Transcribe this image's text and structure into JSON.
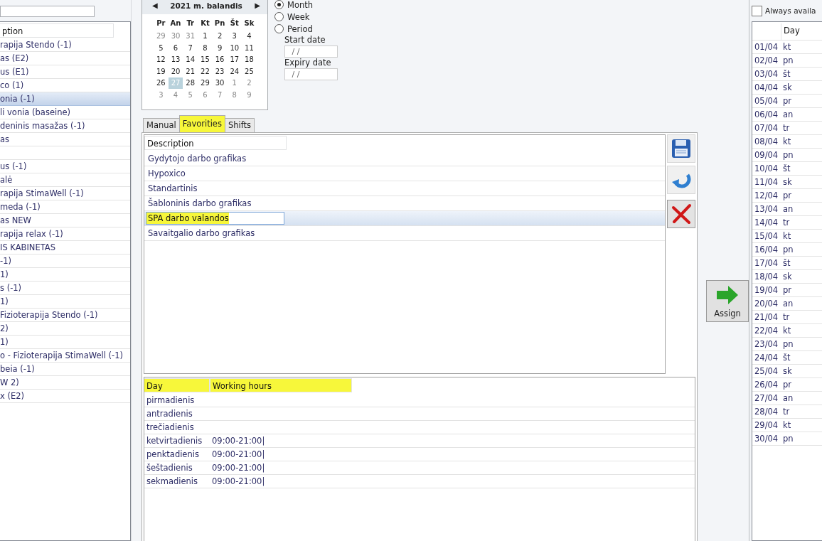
{
  "left_panel": {
    "column": "ption",
    "rows": [
      {
        "text": "rapija Stendo (-1)",
        "selected": false
      },
      {
        "text": "as (E2)",
        "selected": false
      },
      {
        "text": "us (E1)",
        "selected": false
      },
      {
        "text": "co (1)",
        "selected": false
      },
      {
        "text": "onia (-1)",
        "selected": true
      },
      {
        "text": "li vonia (baseine)",
        "selected": false
      },
      {
        "text": "deninis masažas (-1)",
        "selected": false
      },
      {
        "text": "as",
        "selected": false
      },
      {
        "text": "",
        "selected": false
      },
      {
        "text": "us (-1)",
        "selected": false
      },
      {
        "text": "alė",
        "selected": false
      },
      {
        "text": "rapija StimaWell (-1)",
        "selected": false
      },
      {
        "text": "meda (-1)",
        "selected": false
      },
      {
        "text": "as NEW",
        "selected": false
      },
      {
        "text": "rapija relax (-1)",
        "selected": false
      },
      {
        "text": "IS KABINETAS",
        "selected": false
      },
      {
        "text": "-1)",
        "selected": false
      },
      {
        "text": "1)",
        "selected": false
      },
      {
        "text": "s (-1)",
        "selected": false
      },
      {
        "text": "1)",
        "selected": false
      },
      {
        "text": " Fizioterapija Stendo (-1)",
        "selected": false
      },
      {
        "text": "2)",
        "selected": false
      },
      {
        "text": "1)",
        "selected": false
      },
      {
        "text": "o - Fizioterapija StimaWell (-1)",
        "selected": false
      },
      {
        "text": "beia (-1)",
        "selected": false
      },
      {
        "text": "W 2)",
        "selected": false
      },
      {
        "text": "x (E2)",
        "selected": false
      }
    ]
  },
  "calendar": {
    "title": "2021 m. balandis",
    "prev": "◀",
    "next": "▶",
    "weekdays": [
      "Pr",
      "An",
      "Tr",
      "Kt",
      "Pn",
      "Št",
      "Sk"
    ],
    "weeks": [
      [
        {
          "d": "29",
          "other": true,
          "selected": false
        },
        {
          "d": "30",
          "other": true,
          "selected": false
        },
        {
          "d": "31",
          "other": true,
          "selected": false
        },
        {
          "d": "1",
          "other": false,
          "selected": false
        },
        {
          "d": "2",
          "other": false,
          "selected": false
        },
        {
          "d": "3",
          "other": false,
          "selected": false
        },
        {
          "d": "4",
          "other": false,
          "selected": false
        }
      ],
      [
        {
          "d": "5",
          "other": false,
          "selected": false
        },
        {
          "d": "6",
          "other": false,
          "selected": false
        },
        {
          "d": "7",
          "other": false,
          "selected": false
        },
        {
          "d": "8",
          "other": false,
          "selected": false
        },
        {
          "d": "9",
          "other": false,
          "selected": false
        },
        {
          "d": "10",
          "other": false,
          "selected": false
        },
        {
          "d": "11",
          "other": false,
          "selected": false
        }
      ],
      [
        {
          "d": "12",
          "other": false,
          "selected": false
        },
        {
          "d": "13",
          "other": false,
          "selected": false
        },
        {
          "d": "14",
          "other": false,
          "selected": false
        },
        {
          "d": "15",
          "other": false,
          "selected": false
        },
        {
          "d": "16",
          "other": false,
          "selected": false
        },
        {
          "d": "17",
          "other": false,
          "selected": false
        },
        {
          "d": "18",
          "other": false,
          "selected": false
        }
      ],
      [
        {
          "d": "19",
          "other": false,
          "selected": false
        },
        {
          "d": "20",
          "other": false,
          "selected": false
        },
        {
          "d": "21",
          "other": false,
          "selected": false
        },
        {
          "d": "22",
          "other": false,
          "selected": false
        },
        {
          "d": "23",
          "other": false,
          "selected": false
        },
        {
          "d": "24",
          "other": false,
          "selected": false
        },
        {
          "d": "25",
          "other": false,
          "selected": false
        }
      ],
      [
        {
          "d": "26",
          "other": false,
          "selected": false
        },
        {
          "d": "27",
          "other": false,
          "selected": true
        },
        {
          "d": "28",
          "other": false,
          "selected": false
        },
        {
          "d": "29",
          "other": false,
          "selected": false
        },
        {
          "d": "30",
          "other": false,
          "selected": false
        },
        {
          "d": "1",
          "other": true,
          "selected": false
        },
        {
          "d": "2",
          "other": true,
          "selected": false
        }
      ],
      [
        {
          "d": "3",
          "other": true,
          "selected": false
        },
        {
          "d": "4",
          "other": true,
          "selected": false
        },
        {
          "d": "5",
          "other": true,
          "selected": false
        },
        {
          "d": "6",
          "other": true,
          "selected": false
        },
        {
          "d": "7",
          "other": true,
          "selected": false
        },
        {
          "d": "8",
          "other": true,
          "selected": false
        },
        {
          "d": "9",
          "other": true,
          "selected": false
        }
      ]
    ]
  },
  "period_options": [
    {
      "label": "Month",
      "selected": true
    },
    {
      "label": "Week",
      "selected": false
    },
    {
      "label": "Period",
      "selected": false
    }
  ],
  "start_date": {
    "label": "Start date",
    "value": " / /"
  },
  "expiry_date": {
    "label": "Expiry date",
    "value": " / /"
  },
  "tabs": [
    {
      "label": "Manual",
      "selected": false,
      "highlighted": false
    },
    {
      "label": "Favorities",
      "selected": true,
      "highlighted": true
    },
    {
      "label": "Shifts",
      "selected": false,
      "highlighted": false
    }
  ],
  "favorites": {
    "column": "Description",
    "rows": [
      {
        "text": "Gydytojo darbo grafikas",
        "selected": false,
        "editing": false
      },
      {
        "text": "Hypoxico",
        "selected": false,
        "editing": false
      },
      {
        "text": "Standartinis",
        "selected": false,
        "editing": false
      },
      {
        "text": "Šabloninis darbo grafikas",
        "selected": false,
        "editing": false
      },
      {
        "text": "SPA darbo valandos",
        "selected": true,
        "editing": true
      },
      {
        "text": "Savaitgalio darbo grafikas",
        "selected": false,
        "editing": false
      }
    ]
  },
  "hours": {
    "columns": [
      {
        "label": "Day",
        "highlighted": true
      },
      {
        "label": "Working hours",
        "highlighted": true
      }
    ],
    "rows": [
      {
        "day": "pirmadienis",
        "hours": ""
      },
      {
        "day": "antradienis",
        "hours": ""
      },
      {
        "day": "trečiadienis",
        "hours": ""
      },
      {
        "day": "ketvirtadienis",
        "hours": "09:00-21:00|"
      },
      {
        "day": "penktadienis",
        "hours": "09:00-21:00|"
      },
      {
        "day": "šeštadienis",
        "hours": "09:00-21:00|"
      },
      {
        "day": "sekmadienis",
        "hours": "09:00-21:00|"
      }
    ]
  },
  "assign_button": {
    "label": "Assign"
  },
  "right_panel": {
    "always_available": {
      "label": "Always availa",
      "checked": false
    },
    "column": "Day",
    "rows": [
      {
        "date": "01/04",
        "day": "kt"
      },
      {
        "date": "02/04",
        "day": "pn"
      },
      {
        "date": "03/04",
        "day": "št"
      },
      {
        "date": "04/04",
        "day": "sk"
      },
      {
        "date": "05/04",
        "day": "pr"
      },
      {
        "date": "06/04",
        "day": "an"
      },
      {
        "date": "07/04",
        "day": "tr"
      },
      {
        "date": "08/04",
        "day": "kt"
      },
      {
        "date": "09/04",
        "day": "pn"
      },
      {
        "date": "10/04",
        "day": "št"
      },
      {
        "date": "11/04",
        "day": "sk"
      },
      {
        "date": "12/04",
        "day": "pr"
      },
      {
        "date": "13/04",
        "day": "an"
      },
      {
        "date": "14/04",
        "day": "tr"
      },
      {
        "date": "15/04",
        "day": "kt"
      },
      {
        "date": "16/04",
        "day": "pn"
      },
      {
        "date": "17/04",
        "day": "št"
      },
      {
        "date": "18/04",
        "day": "sk"
      },
      {
        "date": "19/04",
        "day": "pr"
      },
      {
        "date": "20/04",
        "day": "an"
      },
      {
        "date": "21/04",
        "day": "tr"
      },
      {
        "date": "22/04",
        "day": "kt"
      },
      {
        "date": "23/04",
        "day": "pn"
      },
      {
        "date": "24/04",
        "day": "št"
      },
      {
        "date": "25/04",
        "day": "sk"
      },
      {
        "date": "26/04",
        "day": "pr"
      },
      {
        "date": "27/04",
        "day": "an"
      },
      {
        "date": "28/04",
        "day": "tr"
      },
      {
        "date": "29/04",
        "day": "kt"
      },
      {
        "date": "30/04",
        "day": "pn"
      }
    ]
  }
}
